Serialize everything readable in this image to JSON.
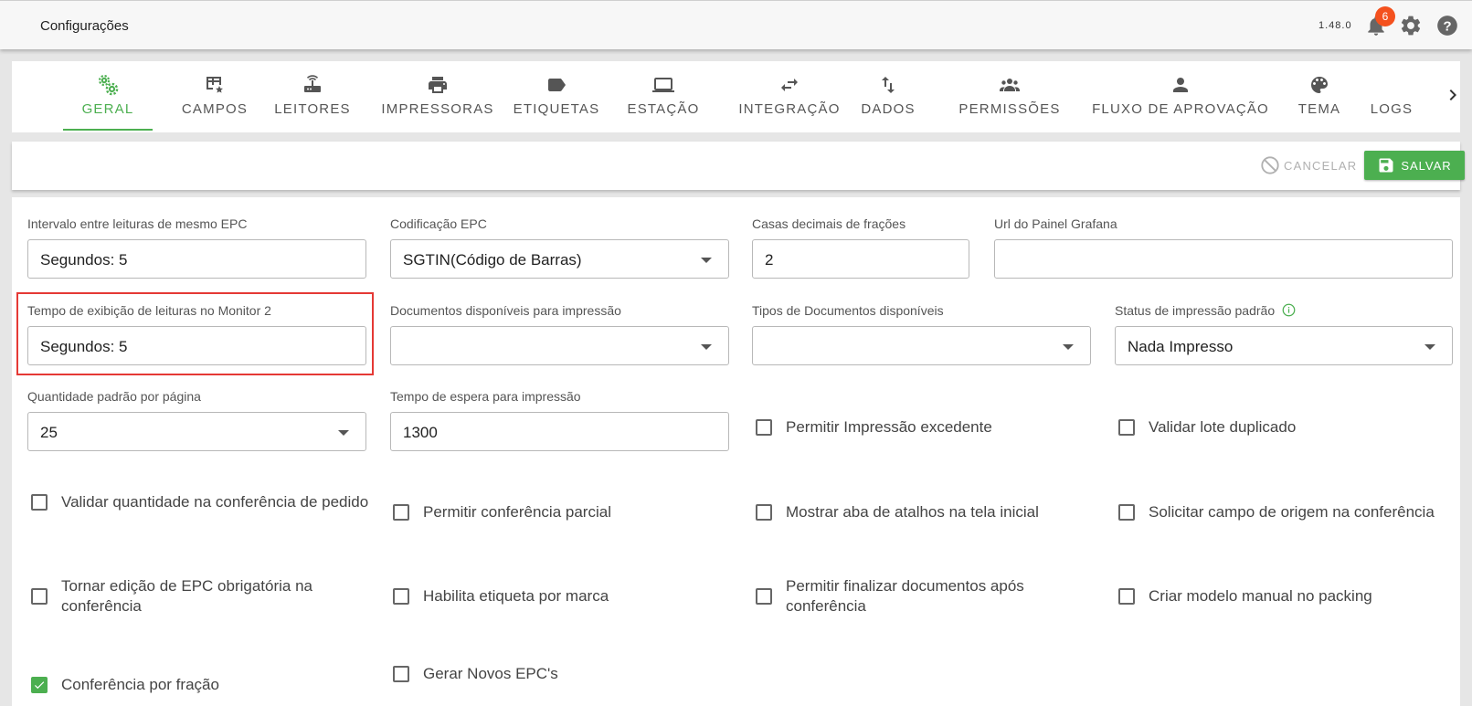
{
  "header": {
    "title": "Configurações",
    "version": "1.48.0",
    "notifications_count": "6"
  },
  "tabs": [
    {
      "label": "GERAL",
      "icon": "cogs-icon"
    },
    {
      "label": "CAMPOS",
      "icon": "table-star-icon"
    },
    {
      "label": "LEITORES",
      "icon": "router-icon"
    },
    {
      "label": "IMPRESSORAS",
      "icon": "printer-icon"
    },
    {
      "label": "ETIQUETAS",
      "icon": "label-icon"
    },
    {
      "label": "ESTAÇÃO",
      "icon": "laptop-icon"
    },
    {
      "label": "INTEGRAÇÃO",
      "icon": "swap-arrows-icon"
    },
    {
      "label": "DADOS",
      "icon": "sort-arrows-icon"
    },
    {
      "label": "PERMISSÕES",
      "icon": "group-icon"
    },
    {
      "label": "FLUXO DE APROVAÇÃO",
      "icon": "person-icon"
    },
    {
      "label": "TEMA",
      "icon": "palette-icon"
    },
    {
      "label": "LOGS",
      "icon": ""
    }
  ],
  "actions": {
    "cancel_label": "CANCELAR",
    "save_label": "SALVAR"
  },
  "fields": {
    "intervalo": {
      "label": "Intervalo entre leituras de mesmo EPC",
      "value": "Segundos: 5"
    },
    "codificacao": {
      "label": "Codificação EPC",
      "value": "SGTIN(Código de Barras)"
    },
    "casas_decimais": {
      "label": "Casas decimais de frações",
      "value": "2"
    },
    "url_grafana": {
      "label": "Url do Painel Grafana",
      "value": ""
    },
    "tempo_exibicao": {
      "label": "Tempo de exibição de leituras no Monitor 2",
      "value": "Segundos: 5"
    },
    "documentos": {
      "label": "Documentos disponíveis para impressão",
      "value": ""
    },
    "tipos_documentos": {
      "label": "Tipos de Documentos disponíveis",
      "value": ""
    },
    "status_impressao": {
      "label": "Status de impressão padrão",
      "value": "Nada Impresso"
    },
    "quantidade_pagina": {
      "label": "Quantidade padrão por página",
      "value": "25"
    },
    "tempo_espera": {
      "label": "Tempo de espera para impressão",
      "value": "1300"
    }
  },
  "checkboxes": {
    "impressao_excedente": {
      "label": "Permitir Impressão excedente",
      "checked": false
    },
    "lote_duplicado": {
      "label": "Validar lote duplicado",
      "checked": false
    },
    "validar_quantidade": {
      "label": "Validar quantidade na conferência de pedido",
      "checked": false
    },
    "conferencia_parcial": {
      "label": "Permitir conferência parcial",
      "checked": false
    },
    "aba_atalhos": {
      "label": "Mostrar aba de atalhos na tela inicial",
      "checked": false
    },
    "campo_origem": {
      "label": "Solicitar campo de origem na conferência",
      "checked": false
    },
    "edicao_epc": {
      "label": "Tornar edição de EPC obrigatória na conferência",
      "checked": false
    },
    "etiqueta_marca": {
      "label": "Habilita etiqueta por marca",
      "checked": false
    },
    "finalizar_documentos": {
      "label": "Permitir finalizar documentos após conferência",
      "checked": false
    },
    "modelo_manual": {
      "label": "Criar modelo manual no packing",
      "checked": false
    },
    "conferencia_fracao": {
      "label": "Conferência por fração",
      "checked": true
    },
    "novos_epcs": {
      "label": "Gerar Novos EPC's",
      "checked": false
    }
  },
  "colors": {
    "accent": "#4caf50",
    "badge": "#f4511e",
    "highlight": "#e53935"
  }
}
